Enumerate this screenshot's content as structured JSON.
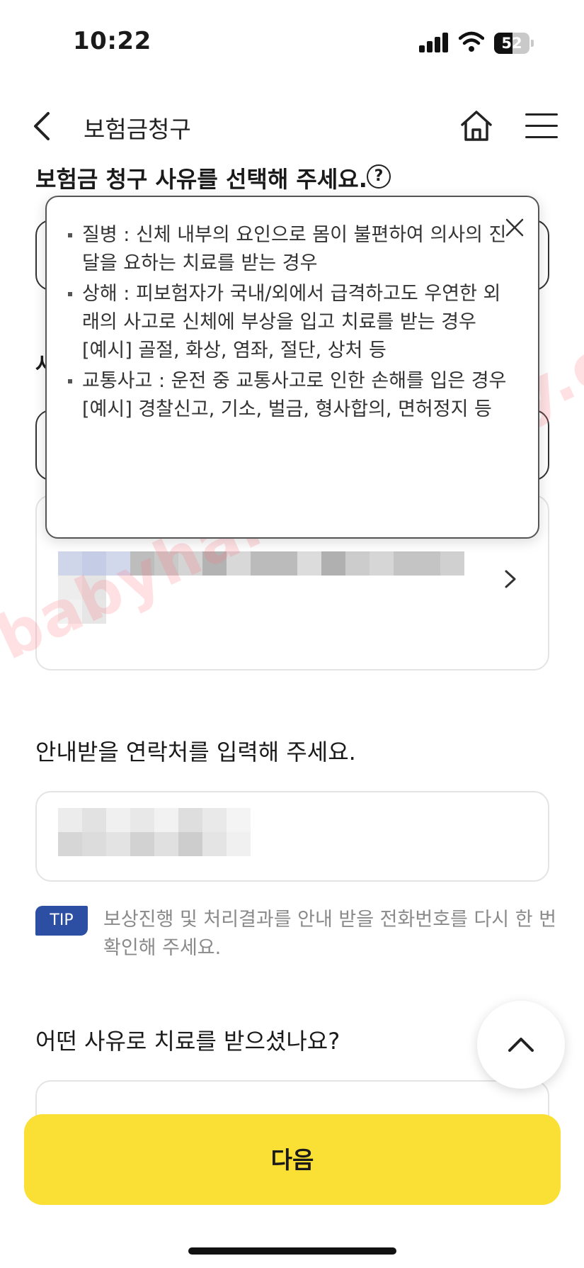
{
  "status_bar": {
    "time": "10:22",
    "battery": "52",
    "battery_level": 0.52
  },
  "header": {
    "title": "보험금청구",
    "back_icon": "chevron-left-icon",
    "home_icon": "home-icon",
    "menu_icon": "hamburger-menu-icon"
  },
  "claim_reason": {
    "question": "보험금 청구 사유를 선택해 주세요.",
    "help_icon": "?"
  },
  "tooltip": {
    "items": [
      {
        "text": "질병 : 신체 내부의 요인으로 몸이 불편하여 의사의 진달을 요하는 치료를 받는 경우",
        "example": ""
      },
      {
        "text": "상해 : 피보험자가 국내/외에서 급격하고도 우연한 외래의 사고로 신체에 부상을 입고 치료를 받는 경우",
        "example": "[예시] 골절, 화상, 염좌, 절단, 상처 등"
      },
      {
        "text": "교통사고 : 운전 중 교통사고로 인한 손해를 입은 경우",
        "example": "[예시] 경찰신고, 기소, 벌금, 형사합의, 면허정지 등"
      }
    ]
  },
  "contact": {
    "title": "안내받을 연락처를 입력해 주세요."
  },
  "tip": {
    "badge": "TIP",
    "text": "보상진행 및 처리결과를 안내 받을 전화번호를 다시 한 번 확인해 주세요."
  },
  "treatment": {
    "title": "어떤 사유로 치료를 받으셨나요?"
  },
  "next_button": {
    "label": "다음"
  },
  "watermark": {
    "text": "babyhand.tistory.com"
  },
  "colors": {
    "primary_button": "#fadf34",
    "tip_badge": "#2d4fa3",
    "tip_text": "#8a8a8a"
  }
}
